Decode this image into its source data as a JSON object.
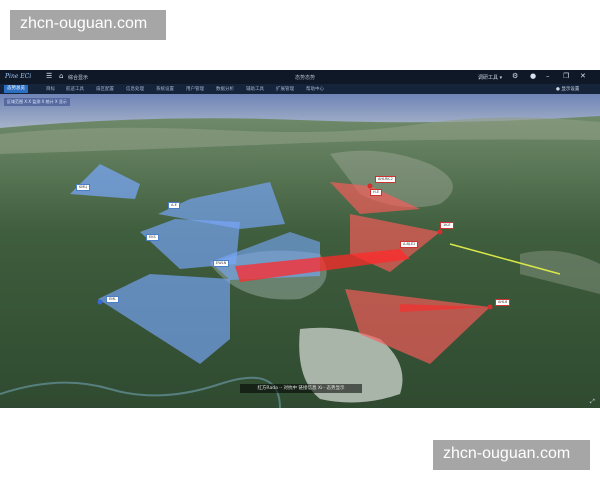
{
  "watermark": {
    "top_text": "zhcn-ouguan.com",
    "bottom_text": "zhcn-ouguan.com"
  },
  "titlebar": {
    "logo": "Pine ECi",
    "home_label": "综合显示",
    "title": "态势态势",
    "user": "调研工具 ▾",
    "icons": [
      "menu-icon",
      "home-icon",
      "settings-icon",
      "user-icon",
      "minimize-icon",
      "restore-icon",
      "close-icon"
    ]
  },
  "menubar": {
    "items": [
      "态势总览",
      "目标",
      "航迹工具",
      "扇区配置",
      "信息处理",
      "系统设置",
      "用户管理",
      "数据分析",
      "辅助工具",
      "扩展管理",
      "帮助中心"
    ],
    "right": "● 显示设置"
  },
  "overlay_label": "区域范围 X:X 监测 X 统计 X 显示",
  "caption": "红方Rada ·· 对抗中 链接信息 Xi·· 态势显示",
  "tags": {
    "blue": [
      "KMLJ",
      "A-E",
      "EKS",
      "EWLN",
      "EML"
    ],
    "red": [
      "1K-E",
      "AHLRK-2",
      "H-E",
      "A-BJ-E2",
      "AHL6"
    ]
  },
  "colors": {
    "red_sector": "#ff5a5a",
    "blue_sector": "#7aa8ff",
    "terrain": "#3d5a3a",
    "water": "#9aa89a"
  }
}
